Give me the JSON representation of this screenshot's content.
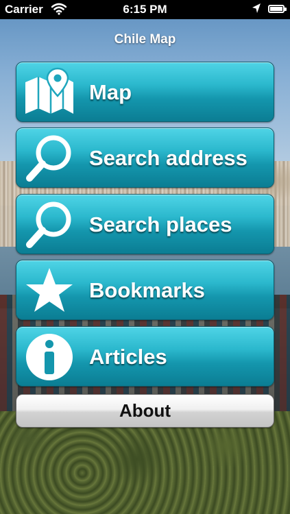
{
  "status_bar": {
    "carrier": "Carrier",
    "time": "6:15 PM",
    "icons": [
      "wifi-icon",
      "location-arrow-icon",
      "battery-icon"
    ]
  },
  "title": "Chile Map",
  "menu": [
    {
      "label": "Map",
      "icon": "map-pin-icon"
    },
    {
      "label": "Search address",
      "icon": "magnifier-icon"
    },
    {
      "label": "Search places",
      "icon": "magnifier-icon"
    },
    {
      "label": "Bookmarks",
      "icon": "star-icon"
    },
    {
      "label": "Articles",
      "icon": "info-icon"
    }
  ],
  "about_label": "About",
  "colors": {
    "button_teal": "#1ea6bd",
    "button_teal_dark": "#0b7d93",
    "about_gray": "#d2d2d2"
  }
}
